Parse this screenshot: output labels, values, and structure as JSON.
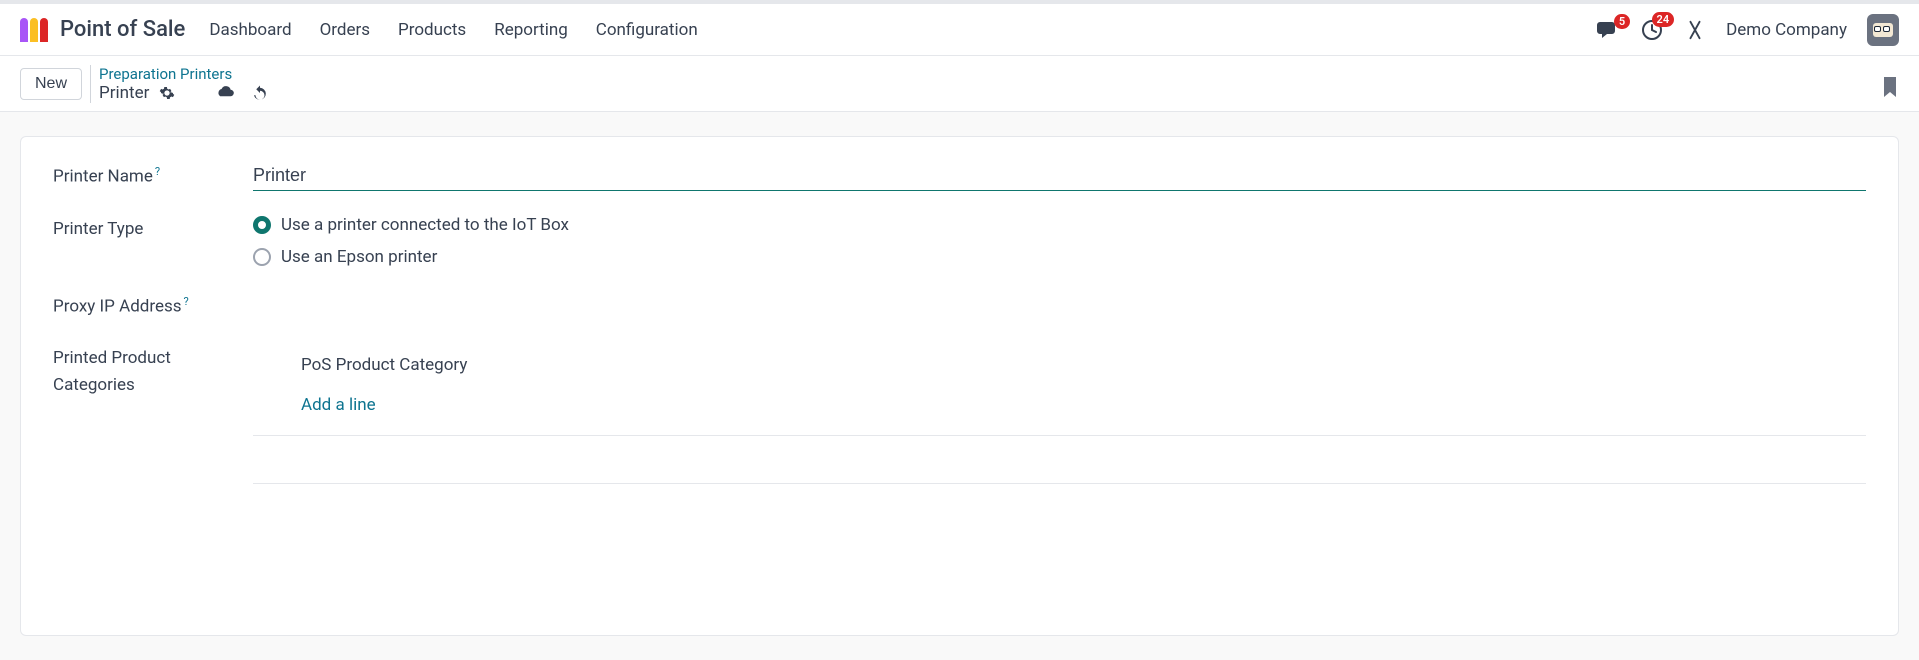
{
  "header": {
    "app_title": "Point of Sale",
    "nav": [
      "Dashboard",
      "Orders",
      "Products",
      "Reporting",
      "Configuration"
    ],
    "messages_badge": "5",
    "activities_badge": "24",
    "company": "Demo Company"
  },
  "controlbar": {
    "new_label": "New",
    "breadcrumb_parent": "Preparation Printers",
    "breadcrumb_current": "Printer"
  },
  "form": {
    "printer_name_label": "Printer Name",
    "help_mark": "?",
    "printer_name_value": "Printer",
    "printer_type_label": "Printer Type",
    "printer_type_options": [
      {
        "label": "Use a printer connected to the IoT Box",
        "checked": true
      },
      {
        "label": "Use an Epson printer",
        "checked": false
      }
    ],
    "proxy_ip_label": "Proxy IP Address",
    "proxy_ip_value": "",
    "printed_categories_label": "Printed Product Categories",
    "category_column": "PoS Product Category",
    "add_line": "Add a line"
  }
}
